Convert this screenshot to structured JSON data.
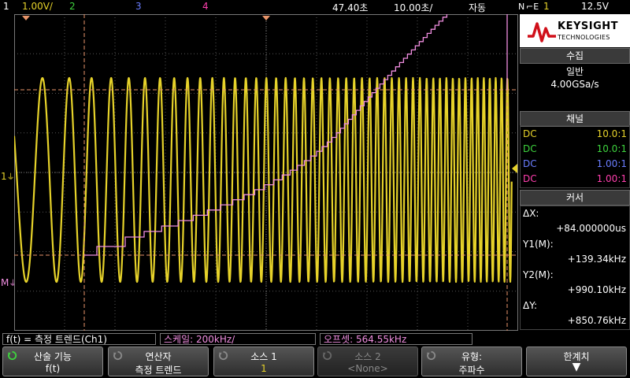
{
  "topbar": {
    "ch1_num": "1",
    "ch1_scale": "1.00V/",
    "ch2_num": "2",
    "ch3_num": "3",
    "ch4_num": "4",
    "timebase_pos": "47.40초",
    "timebase_scale": "10.00초/",
    "trigger_mode": "자동",
    "trigger_label": "N",
    "trigger_source": "1",
    "trigger_level": "12.5V"
  },
  "screen": {
    "left_marker_1": "1",
    "left_marker_m": "M",
    "colors": {
      "ch1": "#e6d22a",
      "math": "#f08ee0",
      "cursor": "#e8956a",
      "grid": "#555"
    }
  },
  "panel": {
    "logo_line1": "KEYSIGHT",
    "logo_line2": "TECHNOLOGIES",
    "acq_title": "수집",
    "acq_mode": "일반",
    "acq_rate": "4.00GSa/s",
    "chan_title": "채널",
    "channels": [
      {
        "coupling": "DC",
        "ratio": "10.0:1",
        "color": "#e6d22a"
      },
      {
        "coupling": "DC",
        "ratio": "10.0:1",
        "color": "#3ed23e"
      },
      {
        "coupling": "DC",
        "ratio": "1.00:1",
        "color": "#6a7dff"
      },
      {
        "coupling": "DC",
        "ratio": "1.00:1",
        "color": "#ff3fae"
      }
    ],
    "cursor_title": "커서",
    "cursors": [
      {
        "label": "ΔX:",
        "value": "+84.000000us"
      },
      {
        "label": "Y1(M):",
        "value": "+139.34kHz"
      },
      {
        "label": "Y2(M):",
        "value": "+990.10kHz"
      },
      {
        "label": "ΔY:",
        "value": "+850.76kHz"
      }
    ]
  },
  "infobar": {
    "func": "f(t) = 측정 트렌드(Ch1)",
    "scale": "스케일: 200kHz/",
    "offset": "오프셋: 564.55kHz"
  },
  "softkeys": [
    {
      "l1": "산술 기능",
      "l2": "f(t)"
    },
    {
      "l1": "연산자",
      "l2": "측정 트렌드"
    },
    {
      "l1": "소스 1",
      "l2": "1"
    },
    {
      "l1": "소스 2",
      "l2": "<None>"
    },
    {
      "l1": "유형:",
      "l2": "주파수"
    },
    {
      "l1": "한계치",
      "l2": ""
    }
  ]
}
